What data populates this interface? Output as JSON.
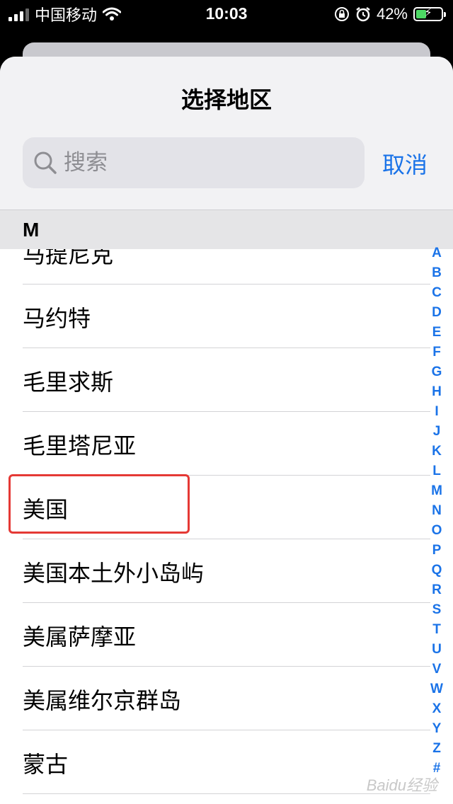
{
  "status_bar": {
    "carrier": "中国移动",
    "time": "10:03",
    "battery_percent": "42%",
    "battery_level": 0.42,
    "icons": [
      "signal-icon",
      "wifi-icon",
      "orientation-lock-icon",
      "alarm-icon",
      "battery-charging-icon"
    ]
  },
  "sheet": {
    "title": "选择地区",
    "search": {
      "placeholder": "搜索",
      "value": ""
    },
    "cancel_label": "取消"
  },
  "section": {
    "letter": "M"
  },
  "regions": [
    "马提尼克",
    "马约特",
    "毛里求斯",
    "毛里塔尼亚",
    "美国",
    "美国本土外小岛屿",
    "美属萨摩亚",
    "美属维尔京群岛",
    "蒙古"
  ],
  "highlighted_region": "美国",
  "index_letters": [
    "A",
    "B",
    "C",
    "D",
    "E",
    "F",
    "G",
    "H",
    "I",
    "J",
    "K",
    "L",
    "M",
    "N",
    "O",
    "P",
    "Q",
    "R",
    "S",
    "T",
    "U",
    "V",
    "W",
    "X",
    "Y",
    "Z",
    "#"
  ],
  "watermark": "Baidu经验",
  "colors": {
    "accent": "#1a73e8",
    "highlight": "#e53935",
    "battery": "#4cd964"
  }
}
